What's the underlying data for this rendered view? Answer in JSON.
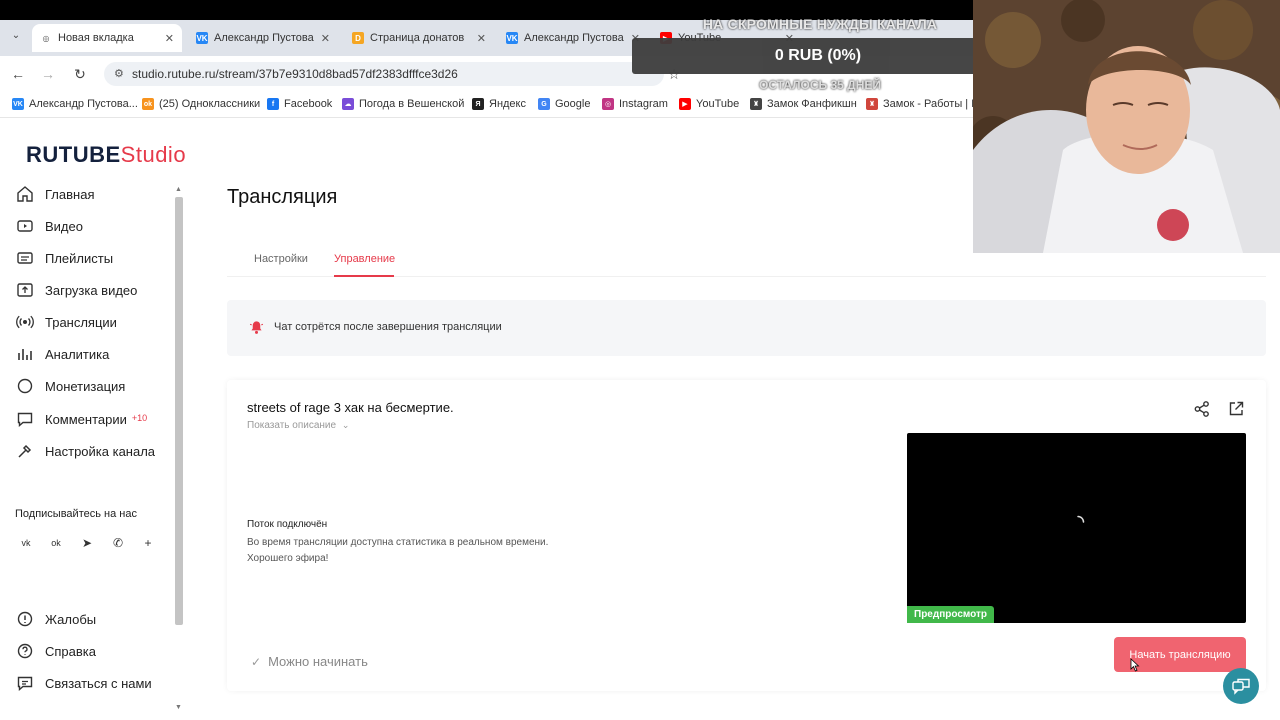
{
  "browser": {
    "tabs": [
      {
        "label": "Новая вкладка",
        "icon": "globe-icon",
        "color": "#5f6368",
        "active": true
      },
      {
        "label": "Александр Пустова",
        "icon": "vk-icon",
        "color": "#2787f5"
      },
      {
        "label": "Страница донатов",
        "icon": "donation-icon",
        "color": "#f5a623"
      },
      {
        "label": "Александр Пустова",
        "icon": "vk-icon",
        "color": "#2787f5"
      },
      {
        "label": "YouTube",
        "icon": "youtube-icon",
        "color": "#ff0000"
      }
    ],
    "url": "studio.rutube.ru/stream/37b7e9310d8bad57df2383dfffce3d26",
    "bookmarks": [
      {
        "label": "Александр Пустова...",
        "icon": "vk-icon",
        "color": "#2787f5"
      },
      {
        "label": "(25) Одноклассники",
        "icon": "ok-icon",
        "color": "#f7931e"
      },
      {
        "label": "Facebook",
        "icon": "facebook-icon",
        "color": "#1877f2"
      },
      {
        "label": "Погода в Вешенской",
        "icon": "weather-icon",
        "color": "#7a4dd8"
      },
      {
        "label": "Яндекс",
        "icon": "yandex-icon",
        "color": "#222222"
      },
      {
        "label": "Google",
        "icon": "google-icon",
        "color": "#4285f4"
      },
      {
        "label": "Instagram",
        "icon": "instagram-icon",
        "color": "#c13584"
      },
      {
        "label": "YouTube",
        "icon": "youtube-icon",
        "color": "#ff0000"
      },
      {
        "label": "Замок Фанфикшн",
        "icon": "castle-icon",
        "color": "#444444"
      },
      {
        "label": "Замок - Работы | Н...",
        "icon": "castle-icon",
        "color": "#d0463c"
      }
    ]
  },
  "overlay": {
    "donation_title": "НА СКРОМНЫЕ НУЖДЫ КАНАЛА",
    "donation_amount": "0 RUB (0%)",
    "donation_days": "ОСТАЛОСЬ 35 ДНЕЙ",
    "donation_progress": 0
  },
  "app": {
    "logo_main": "RUTUBE",
    "logo_sub": "Studio",
    "accent": "#e63a4a"
  },
  "sidebar": {
    "items": [
      {
        "label": "Главная",
        "icon": "home-icon"
      },
      {
        "label": "Видео",
        "icon": "video-icon"
      },
      {
        "label": "Плейлисты",
        "icon": "playlist-icon"
      },
      {
        "label": "Загрузка видео",
        "icon": "upload-icon"
      },
      {
        "label": "Трансляции",
        "icon": "broadcast-icon"
      },
      {
        "label": "Аналитика",
        "icon": "analytics-icon"
      },
      {
        "label": "Монетизация",
        "icon": "monetization-icon"
      },
      {
        "label": "Комментарии",
        "icon": "comments-icon",
        "badge": "+10"
      },
      {
        "label": "Настройка канала",
        "icon": "settings-icon"
      }
    ],
    "subscribe_label": "Подписывайтесь на нас",
    "social": [
      "vk-icon",
      "ok-icon",
      "telegram-icon",
      "viber-icon",
      "plus-icon"
    ],
    "bottom_items": [
      {
        "label": "Жалобы",
        "icon": "report-icon"
      },
      {
        "label": "Справка",
        "icon": "help-icon"
      },
      {
        "label": "Связаться с нами",
        "icon": "contact-icon"
      }
    ]
  },
  "main": {
    "title": "Трансляция",
    "tabs": [
      {
        "label": "Настройки",
        "active": false
      },
      {
        "label": "Управление",
        "active": true
      }
    ],
    "notice": "Чат сотрётся после завершения трансляции",
    "stream_title": "streets of rage 3 хак на бесмертие.",
    "show_description": "Показать описание",
    "status_title": "Поток подключён",
    "status_line1": "Во время трансляции доступна статистика в реальном времени.",
    "status_line2": "Хорошего эфира!",
    "preview_label": "Предпросмотр",
    "ready_label": "Можно начинать",
    "start_button": "Начать трансляцию"
  }
}
